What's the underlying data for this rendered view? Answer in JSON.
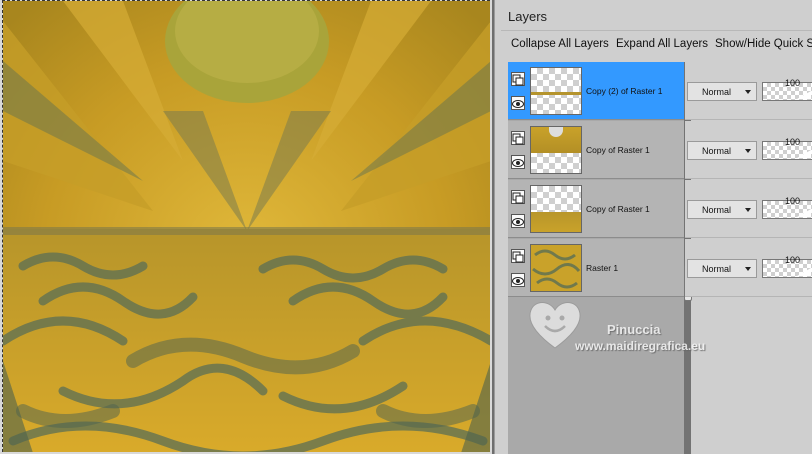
{
  "panel": {
    "title": "Layers",
    "toolbar": {
      "collapse_all": "Collapse All Layers",
      "expand_all": "Expand All Layers",
      "show_hide_quick": "Show/Hide Quick S"
    }
  },
  "layers": [
    {
      "name": "Copy (2) of Raster 1",
      "blend_mode": "Normal",
      "opacity": "100",
      "selected": true
    },
    {
      "name": "Copy of Raster 1",
      "blend_mode": "Normal",
      "opacity": "100",
      "selected": false
    },
    {
      "name": "Copy of Raster 1",
      "blend_mode": "Normal",
      "opacity": "100",
      "selected": false
    },
    {
      "name": "Raster 1",
      "blend_mode": "Normal",
      "opacity": "100",
      "selected": false
    }
  ],
  "watermark": {
    "name": "Pinuccia",
    "site": "www.maidiregrafica.eu"
  },
  "colors": {
    "canvas_gold": "#c9a22a",
    "canvas_dark": "#5b6f55",
    "selection_blue": "#3399ff"
  }
}
